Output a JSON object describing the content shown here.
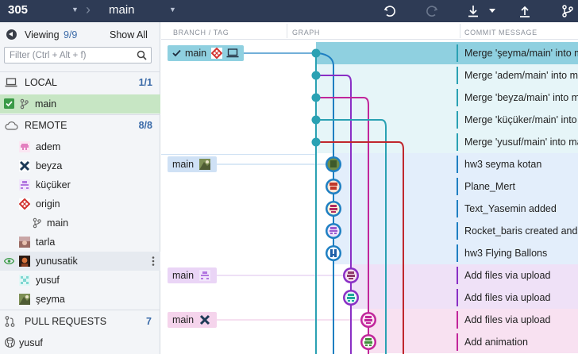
{
  "toolbar": {
    "repo": "305",
    "branch": "main"
  },
  "left": {
    "viewing_label": "Viewing",
    "viewing_count": "9/9",
    "show_all": "Show All",
    "filter_placeholder": "Filter (Ctrl + Alt + f)",
    "local": {
      "label": "LOCAL",
      "count": "1/1",
      "items": [
        {
          "label": "main"
        }
      ]
    },
    "remote": {
      "label": "REMOTE",
      "count": "8/8",
      "items": [
        {
          "label": "adem"
        },
        {
          "label": "beyza"
        },
        {
          "label": "küçüker"
        },
        {
          "label": "origin"
        },
        {
          "label": "main"
        },
        {
          "label": "tarla"
        },
        {
          "label": "yunusatik"
        },
        {
          "label": "yusuf"
        },
        {
          "label": "şeyma"
        }
      ]
    },
    "pull_requests": {
      "label": "PULL REQUESTS",
      "count": "7",
      "items": [
        {
          "label": "yusuf"
        }
      ]
    }
  },
  "graph": {
    "columns": {
      "branch": "BRANCH / TAG",
      "graph": "GRAPH",
      "message": "COMMIT MESSAGE"
    },
    "colors": {
      "blue": "#1e7fc2",
      "purple": "#8a2fc5",
      "magenta": "#c1269b",
      "teal": "#2aa1b3",
      "red": "#c0272d",
      "head": "#8fd0e0"
    },
    "tags": [
      "main",
      "main",
      "main",
      "main"
    ],
    "commits": [
      "Merge 'şeyma/main' into main",
      "Merge 'adem/main' into main",
      "Merge 'beyza/main' into main",
      "Merge 'küçüker/main' into main",
      "Merge 'yusuf/main' into main",
      "hw3 seyma kotan",
      "Plane_Mert",
      "Text_Yasemin added",
      "Rocket_baris created and added",
      "hw3 Flying Ballons",
      "Add files via upload",
      "Add files via upload",
      "Add files via upload",
      "Add animation"
    ]
  }
}
